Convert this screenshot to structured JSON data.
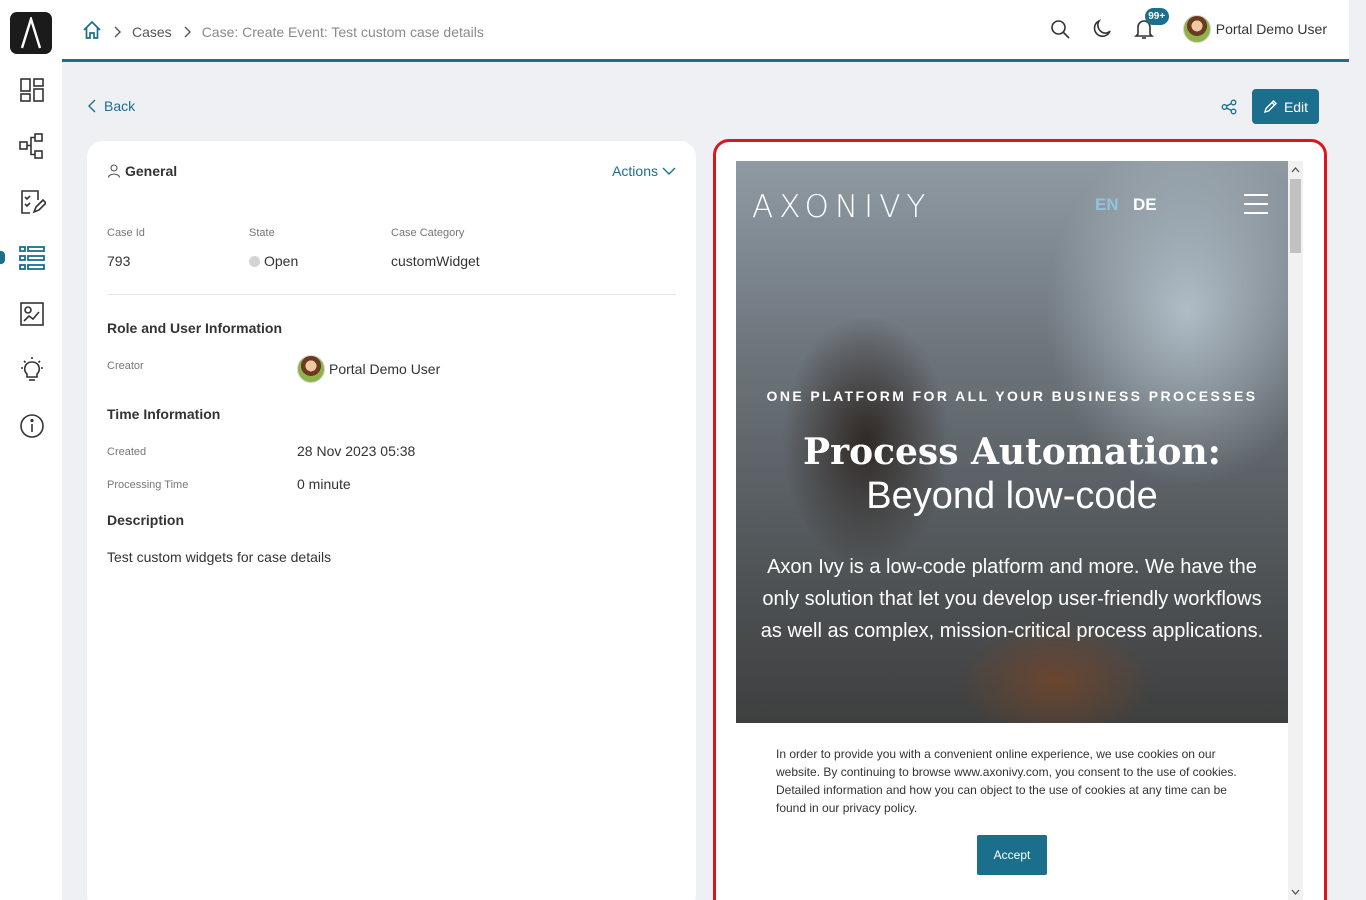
{
  "sidebar": {
    "logo_icon": "axon-ivy-logo-icon",
    "items": [
      {
        "name": "dashboard",
        "icon": "dashboard-icon"
      },
      {
        "name": "processes",
        "icon": "process-icon"
      },
      {
        "name": "tasks",
        "icon": "task-icon"
      },
      {
        "name": "cases",
        "icon": "case-list-icon",
        "active": true
      },
      {
        "name": "statistics",
        "icon": "statistics-icon"
      },
      {
        "name": "ideas",
        "icon": "lightbulb-icon"
      },
      {
        "name": "about",
        "icon": "info-icon"
      }
    ]
  },
  "header": {
    "breadcrumb": {
      "home_icon": "home-icon",
      "cases": "Cases",
      "current": "Case: Create Event: Test custom case details"
    },
    "notification_badge": "99+",
    "user_name": "Portal Demo User"
  },
  "toolbar": {
    "back_label": "Back",
    "edit_label": "Edit"
  },
  "general": {
    "title": "General",
    "actions_label": "Actions",
    "case_id_label": "Case Id",
    "case_id": "793",
    "state_label": "State",
    "state": "Open",
    "category_label": "Case Category",
    "category": "customWidget",
    "role_section": "Role and User Information",
    "creator_label": "Creator",
    "creator": "Portal Demo User",
    "time_section": "Time Information",
    "created_label": "Created",
    "created": "28 Nov 2023 05:38",
    "processing_label": "Processing Time",
    "processing": "0 minute",
    "description_section": "Description",
    "description": "Test custom widgets for case details"
  },
  "widget": {
    "logo_text": "AXONIVY",
    "lang_en": "EN",
    "lang_de": "DE",
    "tagline": "ONE PLATFORM FOR ALL YOUR BUSINESS PROCESSES",
    "headline": "Process Automation:",
    "subheadline": "Beyond low-code",
    "body": "Axon Ivy is a low-code platform and more. We have the only solution that let you develop user-friendly workflows as well as complex, mission-critical process applications.",
    "cookie_text": "In order to provide you with a convenient online experience, we use cookies on our website. By continuing to browse www.axonivy.com, you consent to the use of cookies. Detailed information and how you can object to the use of cookies at any time can be found in our privacy policy.",
    "accept_label": "Accept"
  },
  "colors": {
    "accent": "#1b6f8c",
    "highlight_border": "#d7191f",
    "lang_active": "#8ec4dc"
  }
}
